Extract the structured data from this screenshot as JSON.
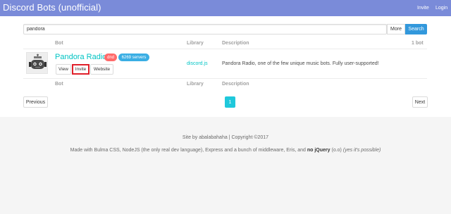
{
  "navbar": {
    "brand": "Discord Bots (unofficial)",
    "links": [
      "Invite",
      "Login"
    ],
    "background": "#7a8bd9"
  },
  "search": {
    "value": "pandora",
    "more_label": "More",
    "search_label": "Search"
  },
  "table": {
    "columns": [
      "Bot",
      "Library",
      "Description",
      "1 bot"
    ],
    "footer_columns": [
      "Bot",
      "Library",
      "Description"
    ],
    "rows": [
      {
        "avatar_icon": "pandora-robot-icon",
        "name": "Pandora Radio",
        "status_tag": "dnd",
        "servers_tag": "6269 servers",
        "buttons": [
          "View",
          "Invite",
          "Website"
        ],
        "library": "discord.js",
        "description": "Pandora Radio, one of the few unique music bots. Fully user-supported!"
      }
    ]
  },
  "pagination": {
    "previous": "Previous",
    "current_page": "1",
    "next": "Next"
  },
  "footer": {
    "credit": "Site by abalabahaha | Copyright ©2017",
    "made_with": "Made with Bulma CSS, NodeJS (the only real dev language), Express and a bunch of middleware, Eris, and",
    "no_jquery": "no jQuery",
    "face": "(o.o)",
    "aside": "(yes it's possible)"
  },
  "colors": {
    "accent": "#00c4c4",
    "search_button": "#3298dc",
    "dnd_tag": "#ff6b6b",
    "servers_tag": "#3aaee4",
    "page_active": "#1fc8db",
    "highlight_border": "#e0202a"
  }
}
